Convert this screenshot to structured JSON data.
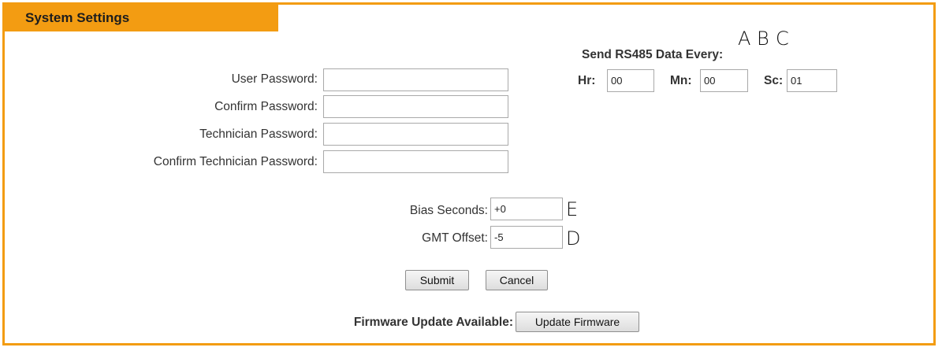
{
  "title": "System Settings",
  "rs485": {
    "heading": "Send RS485 Data Every:",
    "hr_label": "Hr:",
    "hr_value": "00",
    "mn_label": "Mn:",
    "mn_value": "00",
    "sc_label": "Sc:",
    "sc_value": "01"
  },
  "passwords": {
    "user_label": "User Password:",
    "user_value": "",
    "confirm_label": "Confirm Password:",
    "confirm_value": "",
    "tech_label": "Technician Password:",
    "tech_value": "",
    "confirm_tech_label": "Confirm Technician Password:",
    "confirm_tech_value": ""
  },
  "time": {
    "bias_label": "Bias Seconds:",
    "bias_value": "+0",
    "gmt_label": "GMT Offset:",
    "gmt_value": "-5"
  },
  "buttons": {
    "submit": "Submit",
    "cancel": "Cancel",
    "update_firmware": "Update Firmware"
  },
  "firmware_label": "Firmware Update Available:",
  "annotations": {
    "a": "A",
    "b": "B",
    "c": "C",
    "d": "D",
    "e": "E"
  },
  "colors": {
    "accent": "#f39c12"
  }
}
